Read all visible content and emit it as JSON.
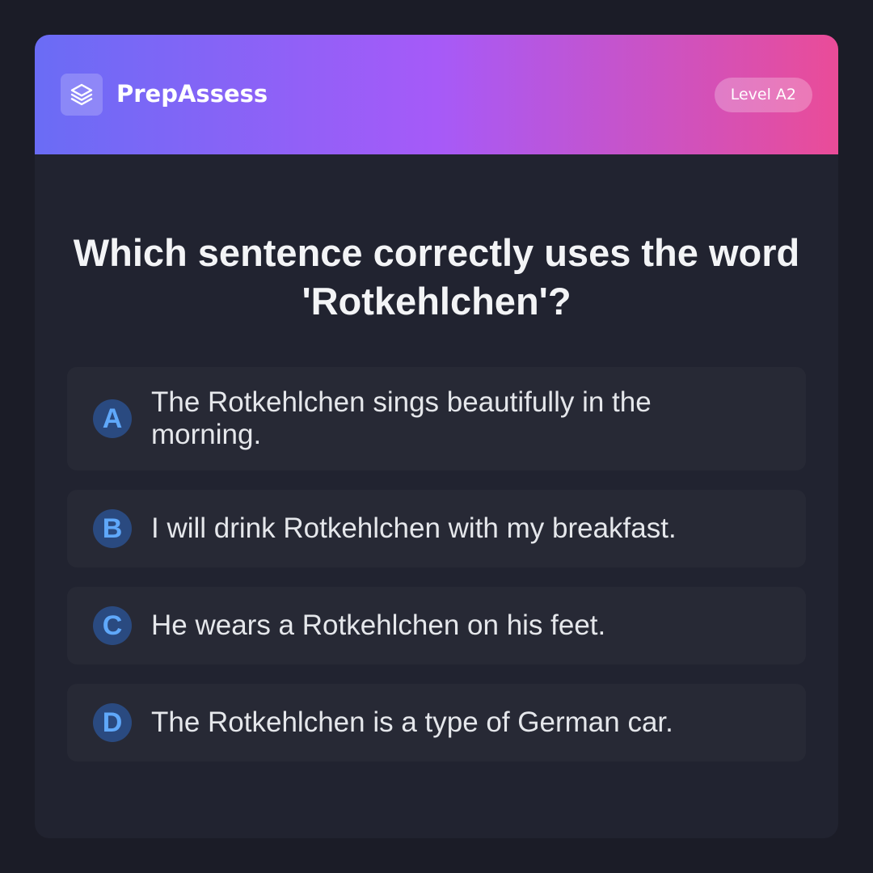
{
  "header": {
    "brand": "PrepAssess",
    "level": "Level A2",
    "logo_icon": "layers-icon",
    "gradient": [
      "#6a6cf5",
      "#a65af8",
      "#ea4c98"
    ]
  },
  "question": {
    "text": "Which sentence correctly uses the word 'Rotkehlchen'?"
  },
  "options": [
    {
      "letter": "A",
      "text": "The Rotkehlchen sings beautifully in the morning."
    },
    {
      "letter": "B",
      "text": "I will drink Rotkehlchen with my breakfast."
    },
    {
      "letter": "C",
      "text": "He wears a Rotkehlchen on his feet."
    },
    {
      "letter": "D",
      "text": "The Rotkehlchen is a type of German car."
    }
  ],
  "colors": {
    "page_background": "#1b1c27",
    "card_background": "#212330",
    "option_background": "#272935",
    "letter_badge_background": "#2a4a80",
    "letter_badge_text": "#5fa8fa"
  }
}
